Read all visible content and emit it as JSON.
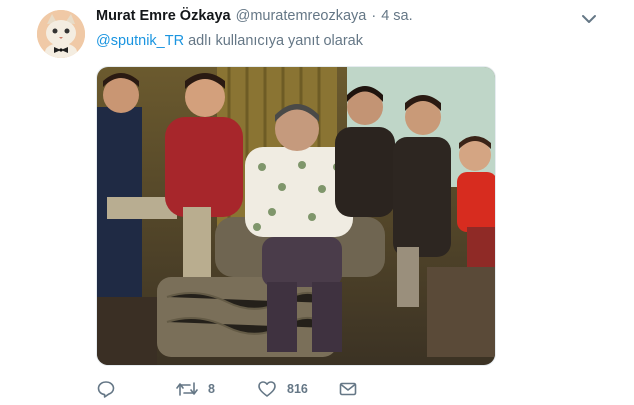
{
  "tweet": {
    "author_name": "Murat Emre Özkaya",
    "author_handle": "@muratemreozkaya",
    "separator": "·",
    "time": "4 sa.",
    "reply_mention": "@sputnik_TR",
    "reply_text": " adlı kullanıcıya yanıt olarak",
    "retweet_count": "8",
    "like_count": "816"
  },
  "icons": {
    "avatar": "cat-with-bowtie-avatar",
    "caret": "chevron-down-icon",
    "reply": "reply-icon",
    "retweet": "retweet-icon",
    "like": "heart-icon",
    "message": "envelope-icon"
  },
  "colors": {
    "link": "#1b95e0",
    "muted": "#657786",
    "text": "#14171a"
  }
}
